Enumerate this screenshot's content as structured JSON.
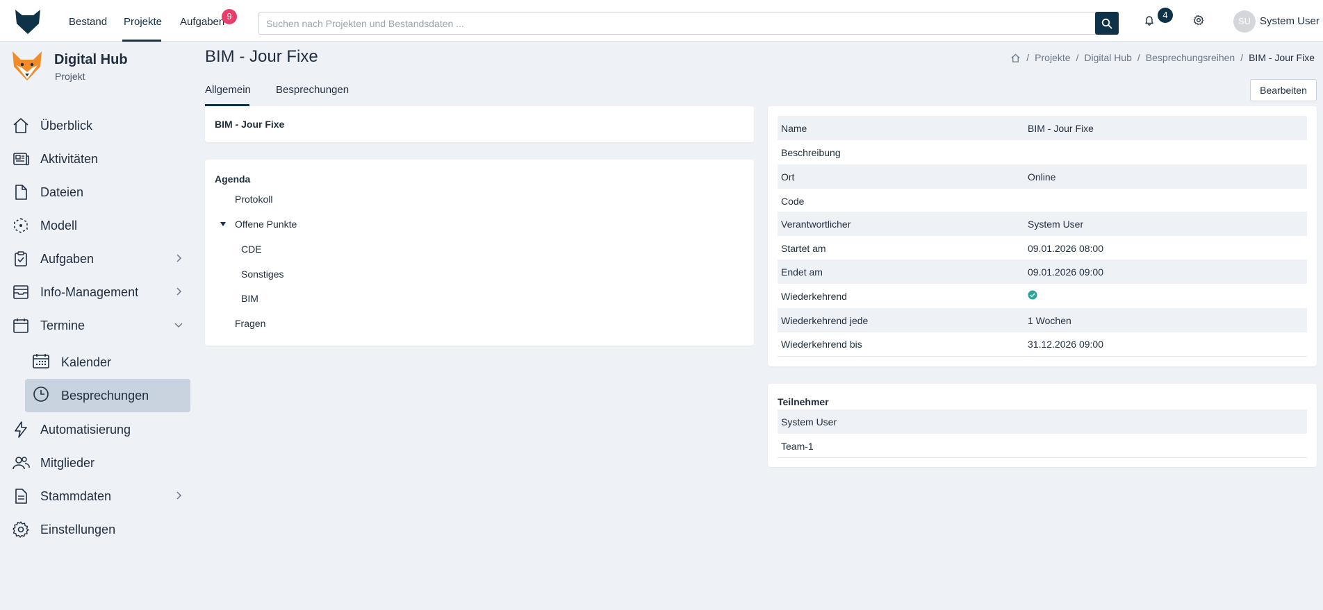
{
  "topnav": {
    "links": [
      "Bestand",
      "Projekte",
      "Aufgaben"
    ],
    "tasks_badge": "9",
    "search_placeholder": "Suchen nach Projekten und Bestandsdaten ...",
    "notifications_badge": "4",
    "user_initials": "SU",
    "user_name": "System User"
  },
  "project": {
    "title": "Digital Hub",
    "subtitle": "Projekt"
  },
  "sidebar": {
    "items": [
      {
        "label": "Überblick",
        "icon": "home-icon"
      },
      {
        "label": "Aktivitäten",
        "icon": "newspaper-icon"
      },
      {
        "label": "Dateien",
        "icon": "file-icon"
      },
      {
        "label": "Modell",
        "icon": "model-icon"
      },
      {
        "label": "Aufgaben",
        "icon": "clipboard-icon"
      },
      {
        "label": "Info-Management",
        "icon": "inbox-icon"
      },
      {
        "label": "Termine",
        "icon": "calendar-icon"
      },
      {
        "label": "Kalender",
        "icon": "calendar-grid-icon"
      },
      {
        "label": "Besprechungen",
        "icon": "clock-icon"
      },
      {
        "label": "Automatisierung",
        "icon": "bolt-icon"
      },
      {
        "label": "Mitglieder",
        "icon": "users-icon"
      },
      {
        "label": "Stammdaten",
        "icon": "document-icon"
      },
      {
        "label": "Einstellungen",
        "icon": "gear-icon"
      }
    ]
  },
  "page": {
    "title": "BIM - Jour Fixe",
    "breadcrumb": [
      "Projekte",
      "Digital Hub",
      "Besprechungsreihen",
      "BIM - Jour Fixe"
    ],
    "tabs": [
      "Allgemein",
      "Besprechungen"
    ],
    "edit_label": "Bearbeiten"
  },
  "summary_card": {
    "title": "BIM - Jour Fixe"
  },
  "agenda": {
    "title": "Agenda",
    "items": [
      "Protokoll",
      "Offene Punkte",
      "CDE",
      "Sonstiges",
      "BIM",
      "Fragen"
    ]
  },
  "details": {
    "rows": [
      {
        "key": "Name",
        "value": "BIM - Jour Fixe"
      },
      {
        "key": "Beschreibung",
        "value": ""
      },
      {
        "key": "Ort",
        "value": "Online"
      },
      {
        "key": "Code",
        "value": ""
      },
      {
        "key": "Verantwortlicher",
        "value": "System User"
      },
      {
        "key": "Startet am",
        "value": "09.01.2026 08:00"
      },
      {
        "key": "Endet am",
        "value": "09.01.2026 09:00"
      },
      {
        "key": "Wiederkehrend",
        "value": ""
      },
      {
        "key": "Wiederkehrend jede",
        "value": "1 Wochen"
      },
      {
        "key": "Wiederkehrend bis",
        "value": "31.12.2026 09:00"
      }
    ]
  },
  "participants": {
    "title": "Teilnehmer",
    "items": [
      "System User",
      "Team-1"
    ]
  },
  "colors": {
    "accent": "#0e3248",
    "badge_red": "#e83e6c",
    "check_green": "#26a69a",
    "background": "#eef2f7"
  }
}
